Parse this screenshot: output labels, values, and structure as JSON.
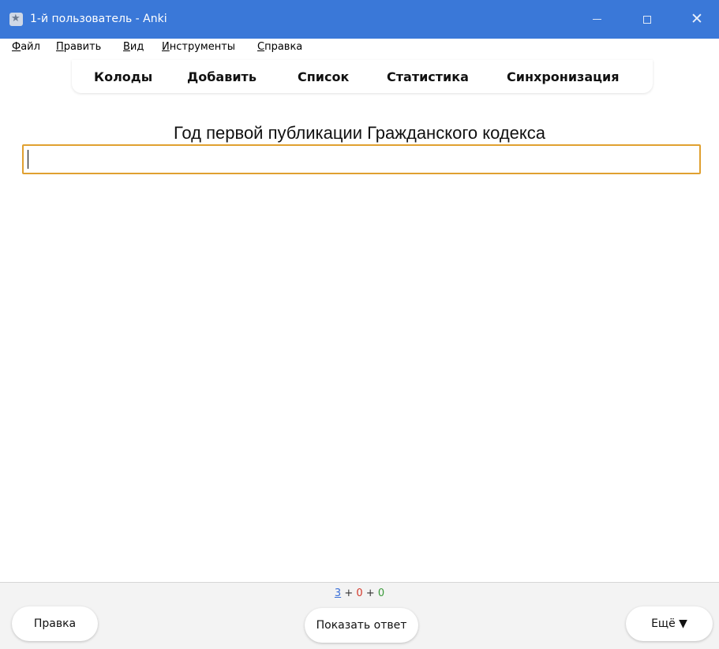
{
  "titlebar": {
    "title": "1-й пользователь - Anki",
    "icon": "anki-app-icon",
    "minimize_icon": "minimize-icon",
    "maximize_icon": "maximize-icon",
    "close_glyph": "✕"
  },
  "menubar": {
    "items": [
      {
        "mnemonic": "Ф",
        "rest": "айл"
      },
      {
        "mnemonic": "П",
        "rest": "равить"
      },
      {
        "mnemonic": "В",
        "rest": "ид"
      },
      {
        "mnemonic": "И",
        "rest": "нструменты"
      },
      {
        "mnemonic": "С",
        "rest": "правка"
      }
    ]
  },
  "toolbar": {
    "items": [
      "Колоды",
      "Добавить",
      "Список",
      "Статистика",
      "Синхронизация"
    ]
  },
  "card": {
    "question": "Год первой публикации Гражданского кодекса",
    "answer_value": ""
  },
  "bottom": {
    "count_new": "3",
    "count_learn": "0",
    "count_review": "0",
    "plus": "+",
    "edit_label": "Правка",
    "show_answer_label": "Показать ответ",
    "more_label": "Ещё ▼"
  },
  "colors": {
    "titlebar": "#3a78d8",
    "input_border": "#e0a030",
    "count_new": "#3a6fd8",
    "count_learn": "#d33a2c",
    "count_review": "#3a9a3a"
  }
}
